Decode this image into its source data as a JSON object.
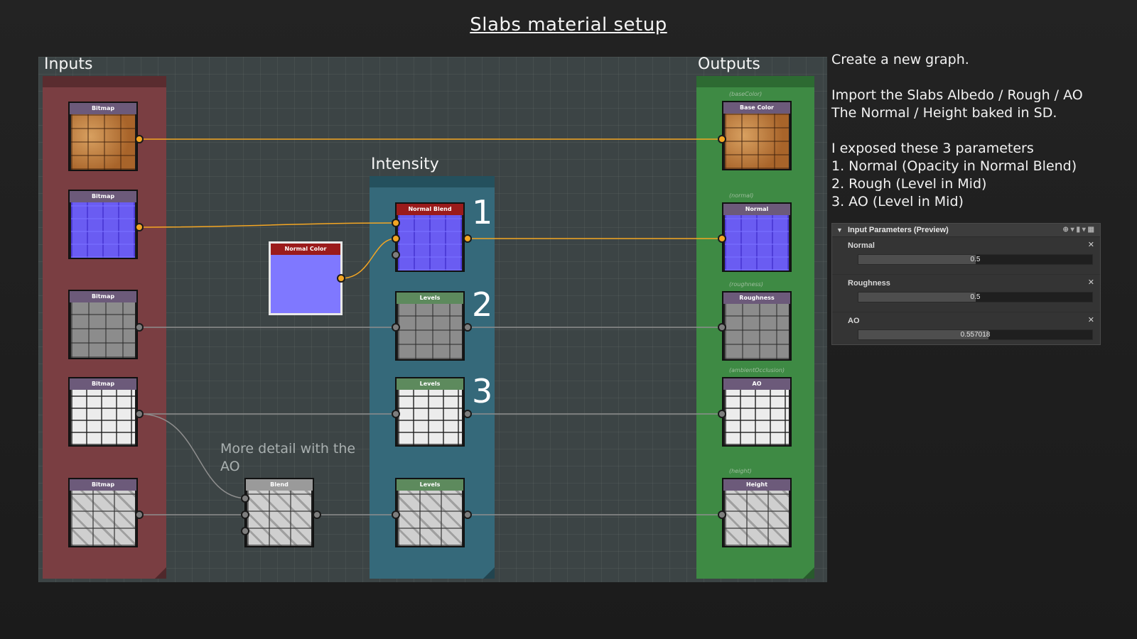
{
  "title": "Slabs material setup",
  "frames": {
    "inputs": "Inputs",
    "intensity": "Intensity",
    "outputs": "Outputs"
  },
  "nodes": {
    "input1": "Bitmap",
    "input2": "Bitmap",
    "input3": "Bitmap",
    "input4": "Bitmap",
    "input5": "Bitmap",
    "normal_color": "Normal Color",
    "normal_blend": "Normal Blend",
    "levels_rough": "Levels",
    "levels_ao": "Levels",
    "levels_height": "Levels",
    "blend": "Blend",
    "out_base": "Base Color",
    "out_normal": "Normal",
    "out_rough": "Roughness",
    "out_ao": "AO",
    "out_height": "Height"
  },
  "output_ids": {
    "base": "(baseColor)",
    "normal": "(normal)",
    "rough": "(roughness)",
    "ao": "(ambientOcclusion)",
    "height": "(height)"
  },
  "markers": [
    "1",
    "2",
    "3"
  ],
  "annotation": [
    "More detail with the",
    "AO"
  ],
  "notes": {
    "line1": "Create a new graph.",
    "line2": "Import the Slabs Albedo / Rough / AO",
    "line3": "The Normal / Height baked in SD.",
    "line4": "I exposed these 3 parameters",
    "line5": "1. Normal (Opacity in Normal Blend)",
    "line6": "2. Rough (Level in Mid)",
    "line7": "3. AO (Level in Mid)"
  },
  "panel": {
    "title": "Input Parameters (Preview)",
    "params": [
      {
        "name": "Normal",
        "value": "0.5",
        "fraction": 0.5
      },
      {
        "name": "Roughness",
        "value": "0.5",
        "fraction": 0.5
      },
      {
        "name": "AO",
        "value": "0.557018",
        "fraction": 0.557
      }
    ]
  },
  "colors": {
    "orange_wire": "#f4a623",
    "gray_wire": "#8e8e8e",
    "inputs_frame": "#7a3e42",
    "intensity_frame": "#35697a",
    "outputs_frame": "#3e8a44"
  }
}
